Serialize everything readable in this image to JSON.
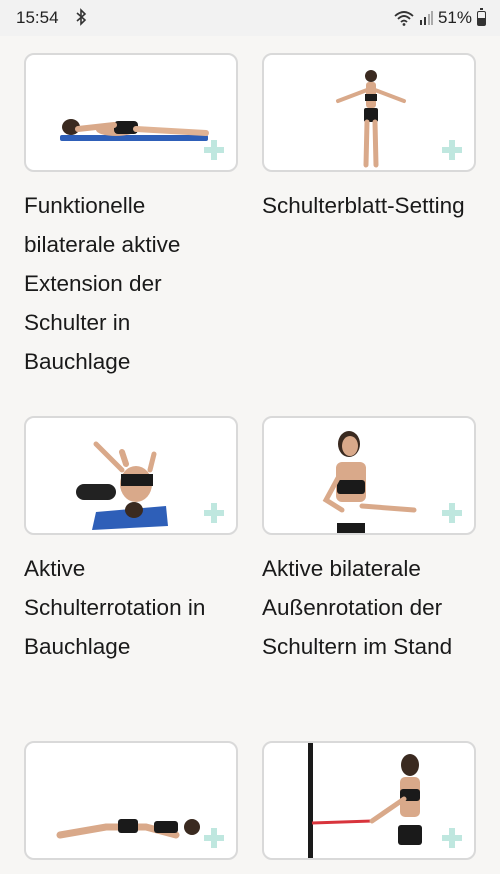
{
  "status_bar": {
    "time": "15:54",
    "battery": "51%"
  },
  "exercises": [
    {
      "title": "Funktionelle bilaterale aktive Extension der Schulter in Bauchlage"
    },
    {
      "title": "Schulterblatt-Setting"
    },
    {
      "title": "Aktive Schulterrotation in Bauchlage"
    },
    {
      "title": "Aktive bilaterale Außenrotation der Schultern im Stand"
    },
    {
      "title": ""
    },
    {
      "title": ""
    }
  ],
  "colors": {
    "accent_plus": "#bfe7df",
    "mat_blue": "#2e5fb8",
    "card_border": "#d9d9d9"
  }
}
